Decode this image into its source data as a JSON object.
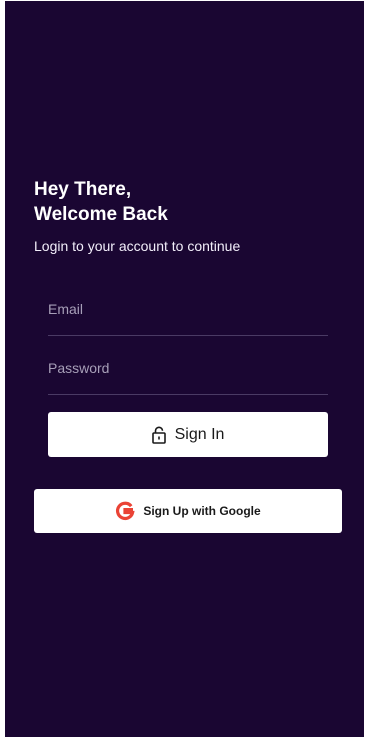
{
  "header": {
    "title_line1": "Hey There,",
    "title_line2": "Welcome Back",
    "subtitle": "Login to your account to continue"
  },
  "form": {
    "email_placeholder": "Email",
    "email_value": "",
    "password_placeholder": "Password",
    "password_value": "",
    "signin_label": "Sign In",
    "signin_icon": "lock-icon",
    "google_label": "Sign Up with Google",
    "google_icon": "google-g-icon"
  },
  "colors": {
    "background": "#1a0632",
    "button": "#ffffff",
    "google_red": "#ea4335"
  }
}
